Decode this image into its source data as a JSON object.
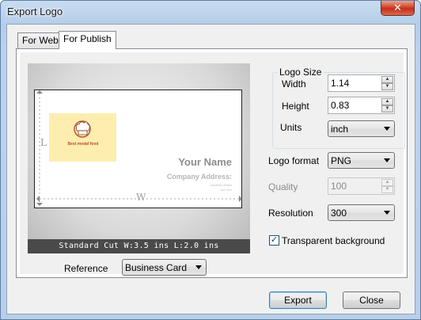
{
  "window": {
    "title": "Export Logo",
    "close_glyph": "✕"
  },
  "tabs": [
    {
      "label": "For Web",
      "active": false
    },
    {
      "label": "For Publish",
      "active": true
    }
  ],
  "preview": {
    "logo_text": "Best medal food",
    "card_name": "Your Name",
    "card_address": "Company Address:",
    "address_line1": "address details",
    "address_line2": "Your line",
    "axis_l": "L",
    "axis_w": "W",
    "dimension_text": "Standard Cut  W:3.5 ins  L:2.0 ins"
  },
  "reference": {
    "label": "Reference",
    "value": "Business Card"
  },
  "logo_size": {
    "title": "Logo Size",
    "width_label": "Width",
    "width_value": "1.14",
    "height_label": "Height",
    "height_value": "0.83",
    "units_label": "Units",
    "units_value": "inch"
  },
  "logo_format": {
    "label": "Logo format",
    "value": "PNG"
  },
  "quality": {
    "label": "Quality",
    "value": "100",
    "enabled": false
  },
  "resolution": {
    "label": "Resolution",
    "value": "300"
  },
  "transparent": {
    "label": "Transparent background",
    "checked": true,
    "check_glyph": "✓"
  },
  "spin_glyphs": {
    "up": "▲",
    "down": "▼"
  },
  "buttons": {
    "export": "Export",
    "close": "Close"
  }
}
